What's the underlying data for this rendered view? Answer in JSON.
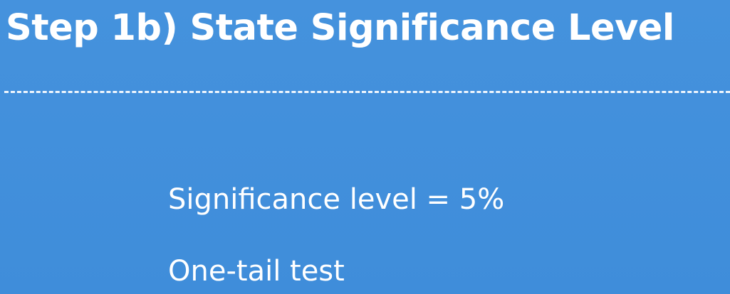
{
  "slide": {
    "title": "Step 1b) State Significance Level",
    "lines": [
      "Significance level = 5%",
      "One-tail test"
    ]
  },
  "colors": {
    "background": "#418fdc",
    "text": "#ffffff"
  }
}
